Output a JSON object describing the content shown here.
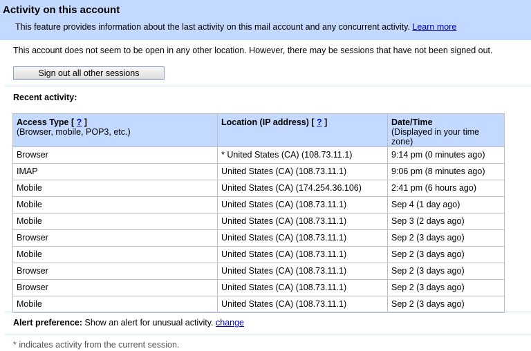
{
  "header": {
    "title": "Activity on this account",
    "description": "This feature provides information about the last activity on this mail account and any concurrent activity.",
    "learn_more": "Learn more"
  },
  "notice": "This account does not seem to be open in any other location. However, there may be sessions that have not been signed out.",
  "signout_button": "Sign out all other sessions",
  "recent_label": "Recent activity:",
  "table": {
    "headers": [
      {
        "main": "Access Type",
        "help": "?",
        "sub": "(Browser, mobile, POP3, etc.)"
      },
      {
        "main": "Location (IP address)",
        "help": "?",
        "sub": ""
      },
      {
        "main": "Date/Time",
        "help": "",
        "sub": "(Displayed in your time zone)"
      }
    ],
    "rows": [
      [
        "Browser",
        "* United States (CA) (108.73.11.1)",
        "9:14 pm (0 minutes ago)"
      ],
      [
        "IMAP",
        "United States (CA) (108.73.11.1)",
        "9:06 pm (8 minutes ago)"
      ],
      [
        "Mobile",
        "United States (CA) (174.254.36.106)",
        "2:41 pm (6 hours ago)"
      ],
      [
        "Mobile",
        "United States (CA) (108.73.11.1)",
        "Sep 4 (1 day ago)"
      ],
      [
        "Mobile",
        "United States (CA) (108.73.11.1)",
        "Sep 3 (2 days ago)"
      ],
      [
        "Browser",
        "United States (CA) (108.73.11.1)",
        "Sep 2 (3 days ago)"
      ],
      [
        "Mobile",
        "United States (CA) (108.73.11.1)",
        "Sep 2 (3 days ago)"
      ],
      [
        "Browser",
        "United States (CA) (108.73.11.1)",
        "Sep 2 (3 days ago)"
      ],
      [
        "Browser",
        "United States (CA) (108.73.11.1)",
        "Sep 2 (3 days ago)"
      ],
      [
        "Mobile",
        "United States (CA) (108.73.11.1)",
        "Sep 2 (3 days ago)"
      ]
    ]
  },
  "alert": {
    "label": "Alert preference:",
    "text": "Show an alert for unusual activity.",
    "change_link": "change"
  },
  "footnote": "* indicates activity from the current session."
}
